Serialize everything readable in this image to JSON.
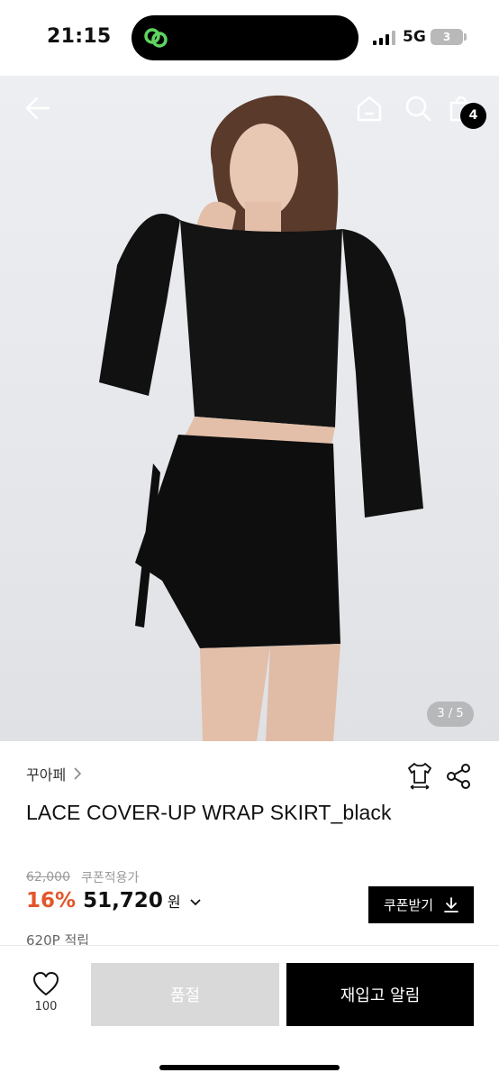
{
  "status_bar": {
    "time": "21:15",
    "network": "5G",
    "battery": "3",
    "island_icon": "link-rings-icon",
    "island_icon_color": "#5fd35f"
  },
  "hero": {
    "pager": "3 / 5",
    "cart_count": "4",
    "icons": [
      "back-arrow-icon",
      "home-icon",
      "search-icon",
      "cart-icon"
    ]
  },
  "product": {
    "brand": "꾸아페",
    "title": "LACE COVER-UP WRAP SKIRT_black",
    "original_price": "62,000",
    "coupon_note": "쿠폰적용가",
    "discount": "16%",
    "price": "51,720",
    "currency": "원",
    "coupon_button": "쿠폰받기",
    "points": "620P 적립"
  },
  "actions": {
    "like_count": "100",
    "soldout": "품절",
    "restock_alert": "재입고 알림"
  },
  "colors": {
    "discount": "#e2562b",
    "primary_button": "#000000",
    "disabled_button": "#d9d9d9"
  }
}
